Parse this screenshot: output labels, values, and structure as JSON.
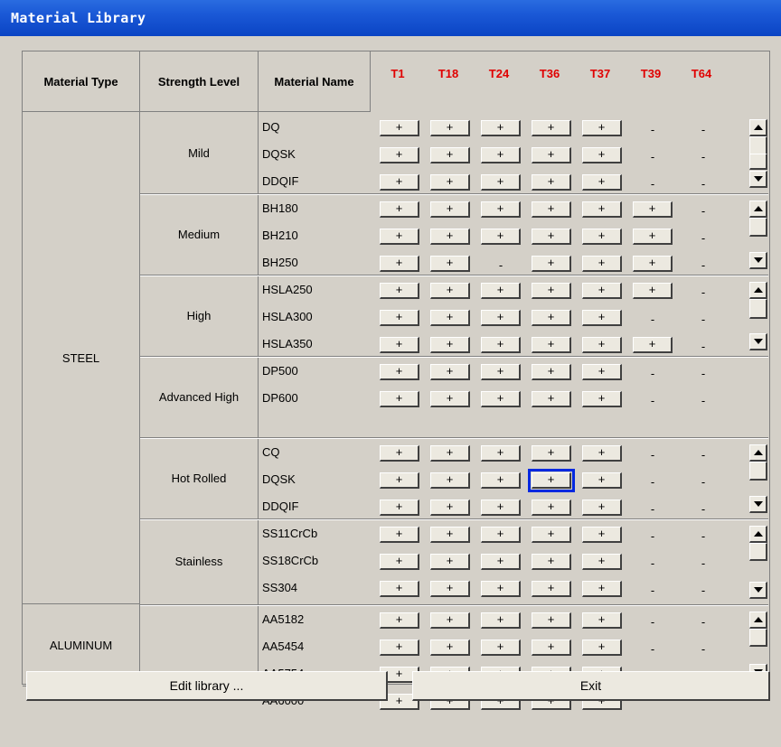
{
  "window": {
    "title": "Material Library"
  },
  "header": {
    "material_type": "Material Type",
    "strength_level": "Strength Level",
    "material_name": "Material Name",
    "thickness_cols": [
      "T1",
      "T18",
      "T24",
      "T36",
      "T37",
      "T39",
      "T64"
    ],
    "thickness_color": "#e00000"
  },
  "types": [
    {
      "name": "STEEL"
    },
    {
      "name": "ALUMINUM"
    }
  ],
  "groups": [
    {
      "label": "Mild",
      "rows": [
        {
          "name": "DQ",
          "cells": [
            "+",
            "+",
            "+",
            "+",
            "+",
            "-",
            "-"
          ]
        },
        {
          "name": "DQSK",
          "cells": [
            "+",
            "+",
            "+",
            "+",
            "+",
            "-",
            "-"
          ]
        },
        {
          "name": "DDQIF",
          "cells": [
            "+",
            "+",
            "+",
            "+",
            "+",
            "-",
            "-"
          ]
        }
      ]
    },
    {
      "label": "Medium",
      "rows": [
        {
          "name": "BH180",
          "cells": [
            "+",
            "+",
            "+",
            "+",
            "+",
            "+",
            "-"
          ]
        },
        {
          "name": "BH210",
          "cells": [
            "+",
            "+",
            "+",
            "+",
            "+",
            "+",
            "-"
          ]
        },
        {
          "name": "BH250",
          "cells": [
            "+",
            "+",
            "-",
            "+",
            "+",
            "+",
            "-"
          ]
        }
      ]
    },
    {
      "label": "High",
      "rows": [
        {
          "name": "HSLA250",
          "cells": [
            "+",
            "+",
            "+",
            "+",
            "+",
            "+",
            "-"
          ]
        },
        {
          "name": "HSLA300",
          "cells": [
            "+",
            "+",
            "+",
            "+",
            "+",
            "-",
            "-"
          ]
        },
        {
          "name": "HSLA350",
          "cells": [
            "+",
            "+",
            "+",
            "+",
            "+",
            "+",
            "-"
          ]
        }
      ]
    },
    {
      "label": "Advanced High",
      "rows": [
        {
          "name": "DP500",
          "cells": [
            "+",
            "+",
            "+",
            "+",
            "+",
            "-",
            "-"
          ]
        },
        {
          "name": "DP600",
          "cells": [
            "+",
            "+",
            "+",
            "+",
            "+",
            "-",
            "-"
          ]
        }
      ]
    },
    {
      "label": "Hot Rolled",
      "rows": [
        {
          "name": "CQ",
          "cells": [
            "+",
            "+",
            "+",
            "+",
            "+",
            "-",
            "-"
          ]
        },
        {
          "name": "DQSK",
          "cells": [
            "+",
            "+",
            "+",
            "+",
            "+",
            "-",
            "-"
          ]
        },
        {
          "name": "DDQIF",
          "cells": [
            "+",
            "+",
            "+",
            "+",
            "+",
            "-",
            "-"
          ]
        }
      ]
    },
    {
      "label": "Stainless",
      "rows": [
        {
          "name": "SS11CrCb",
          "cells": [
            "+",
            "+",
            "+",
            "+",
            "+",
            "-",
            "-"
          ]
        },
        {
          "name": "SS18CrCb",
          "cells": [
            "+",
            "+",
            "+",
            "+",
            "+",
            "-",
            "-"
          ]
        },
        {
          "name": "SS304",
          "cells": [
            "+",
            "+",
            "+",
            "+",
            "+",
            "-",
            "-"
          ]
        }
      ]
    },
    {
      "label": "",
      "rows": [
        {
          "name": "AA5182",
          "cells": [
            "+",
            "+",
            "+",
            "+",
            "+",
            "-",
            "-"
          ]
        },
        {
          "name": "AA5454",
          "cells": [
            "+",
            "+",
            "+",
            "+",
            "+",
            "-",
            "-"
          ]
        },
        {
          "name": "AA5754",
          "cells": [
            "+",
            "+",
            "+",
            "+",
            "+",
            "-",
            "-"
          ]
        },
        {
          "name": "AA6000",
          "cells": [
            "+",
            "+",
            "+",
            "+",
            "+",
            "",
            ""
          ]
        }
      ]
    }
  ],
  "selected": {
    "group": 4,
    "row": 1,
    "col": 3
  },
  "footer": {
    "edit_label": "Edit library ...",
    "exit_label": "Exit"
  }
}
